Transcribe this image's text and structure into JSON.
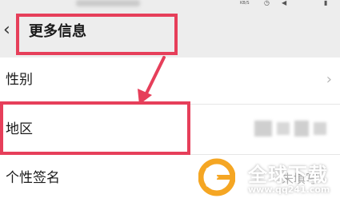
{
  "status_bar": {
    "speed": "KB/S",
    "alarm_icon": "alarm-icon",
    "mute_icon": "mute-icon",
    "signal_icon": "signal-icon"
  },
  "header": {
    "back_icon": "back-chevron-icon",
    "title": "更多信息"
  },
  "rows": [
    {
      "label": "性别",
      "has_chevron": true,
      "value": ""
    },
    {
      "label": "地区",
      "has_chevron": false,
      "value": ""
    },
    {
      "label": "个性签名",
      "has_chevron": false,
      "value": "未填写"
    }
  ],
  "annotation": {
    "color": "#e63f5a"
  },
  "watermark": {
    "title": "全球下载",
    "url": "www.qq241.com",
    "logo_color": "#f5a623"
  },
  "colors": {
    "page_bg": "#ededed",
    "row_bg": "#ffffff",
    "text": "#1a1a1a",
    "chevron": "#b5b5b5"
  }
}
